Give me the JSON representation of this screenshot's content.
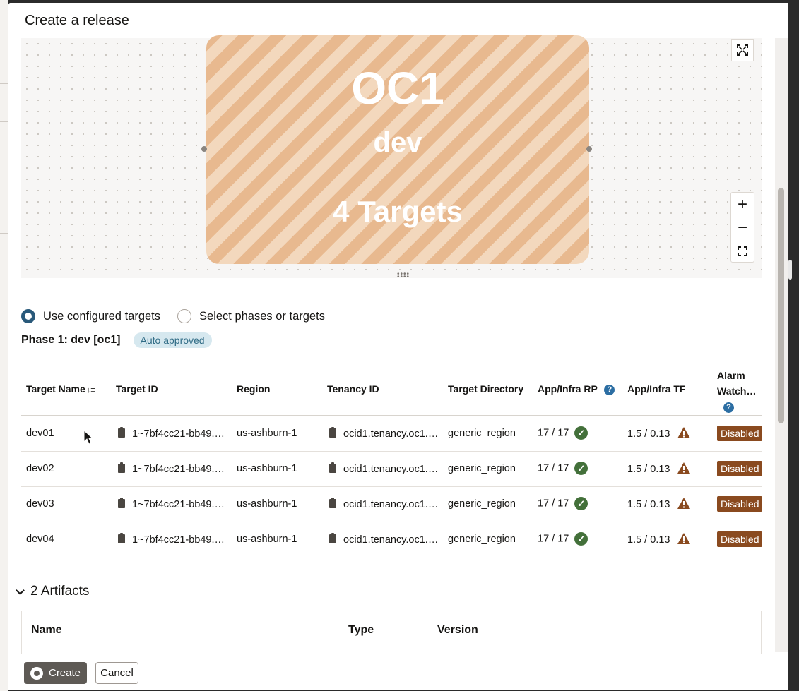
{
  "dialog": {
    "title": "Create a release"
  },
  "canvas": {
    "phase_card": {
      "region": "OC1",
      "name": "dev",
      "targets": "4 Targets"
    }
  },
  "target_options": {
    "use_configured": "Use configured targets",
    "select_phases": "Select phases or targets",
    "selected": "use_configured"
  },
  "phase": {
    "label": "Phase 1:",
    "name": "dev [oc1]",
    "badge": "Auto approved"
  },
  "targets_table": {
    "columns": {
      "target_name": "Target Name",
      "target_id": "Target ID",
      "region": "Region",
      "tenancy_id": "Tenancy ID",
      "target_directory": "Target Directory",
      "app_infra_rp": "App/Infra RP",
      "app_infra_tf": "App/Infra TF",
      "alarm_watch_line1": "Alarm",
      "alarm_watch_line2": "Watch…"
    },
    "rows": [
      {
        "name": "dev01",
        "target_id": "1~7bf4cc21-bb49.…",
        "region": "us-ashburn-1",
        "tenancy_id": "ocid1.tenancy.oc1.…",
        "directory": "generic_region",
        "rp": "17 / 17",
        "tf": "1.5 / 0.13",
        "alarm": "Disabled"
      },
      {
        "name": "dev02",
        "target_id": "1~7bf4cc21-bb49.…",
        "region": "us-ashburn-1",
        "tenancy_id": "ocid1.tenancy.oc1.…",
        "directory": "generic_region",
        "rp": "17 / 17",
        "tf": "1.5 / 0.13",
        "alarm": "Disabled"
      },
      {
        "name": "dev03",
        "target_id": "1~7bf4cc21-bb49.…",
        "region": "us-ashburn-1",
        "tenancy_id": "ocid1.tenancy.oc1.…",
        "directory": "generic_region",
        "rp": "17 / 17",
        "tf": "1.5 / 0.13",
        "alarm": "Disabled"
      },
      {
        "name": "dev04",
        "target_id": "1~7bf4cc21-bb49.…",
        "region": "us-ashburn-1",
        "tenancy_id": "ocid1.tenancy.oc1.…",
        "directory": "generic_region",
        "rp": "17 / 17",
        "tf": "1.5 / 0.13",
        "alarm": "Disabled"
      }
    ]
  },
  "artifacts": {
    "toggle_label": "2 Artifacts",
    "columns": {
      "name": "Name",
      "type": "Type",
      "version": "Version"
    }
  },
  "footer": {
    "create_label": "Create",
    "cancel_label": "Cancel"
  },
  "colors": {
    "primary_radio": "#29597a",
    "phase_card_stripe_a": "#e8b98f",
    "phase_card_stripe_b": "#f3d8bd",
    "ok_green": "#43703a",
    "warning_brown": "#8a4a1f",
    "disabled_badge": "#8a4a1f",
    "auto_badge_bg": "#d6e8ef"
  },
  "icons": {
    "expand": "expand-icon",
    "zoom_in": "plus-icon",
    "zoom_out": "minus-icon",
    "fit": "fit-screen-icon",
    "copy": "clipboard-icon",
    "ok": "check-circle-icon",
    "warning": "warning-triangle-icon",
    "help": "help-icon",
    "sort": "sort-desc-icon"
  }
}
